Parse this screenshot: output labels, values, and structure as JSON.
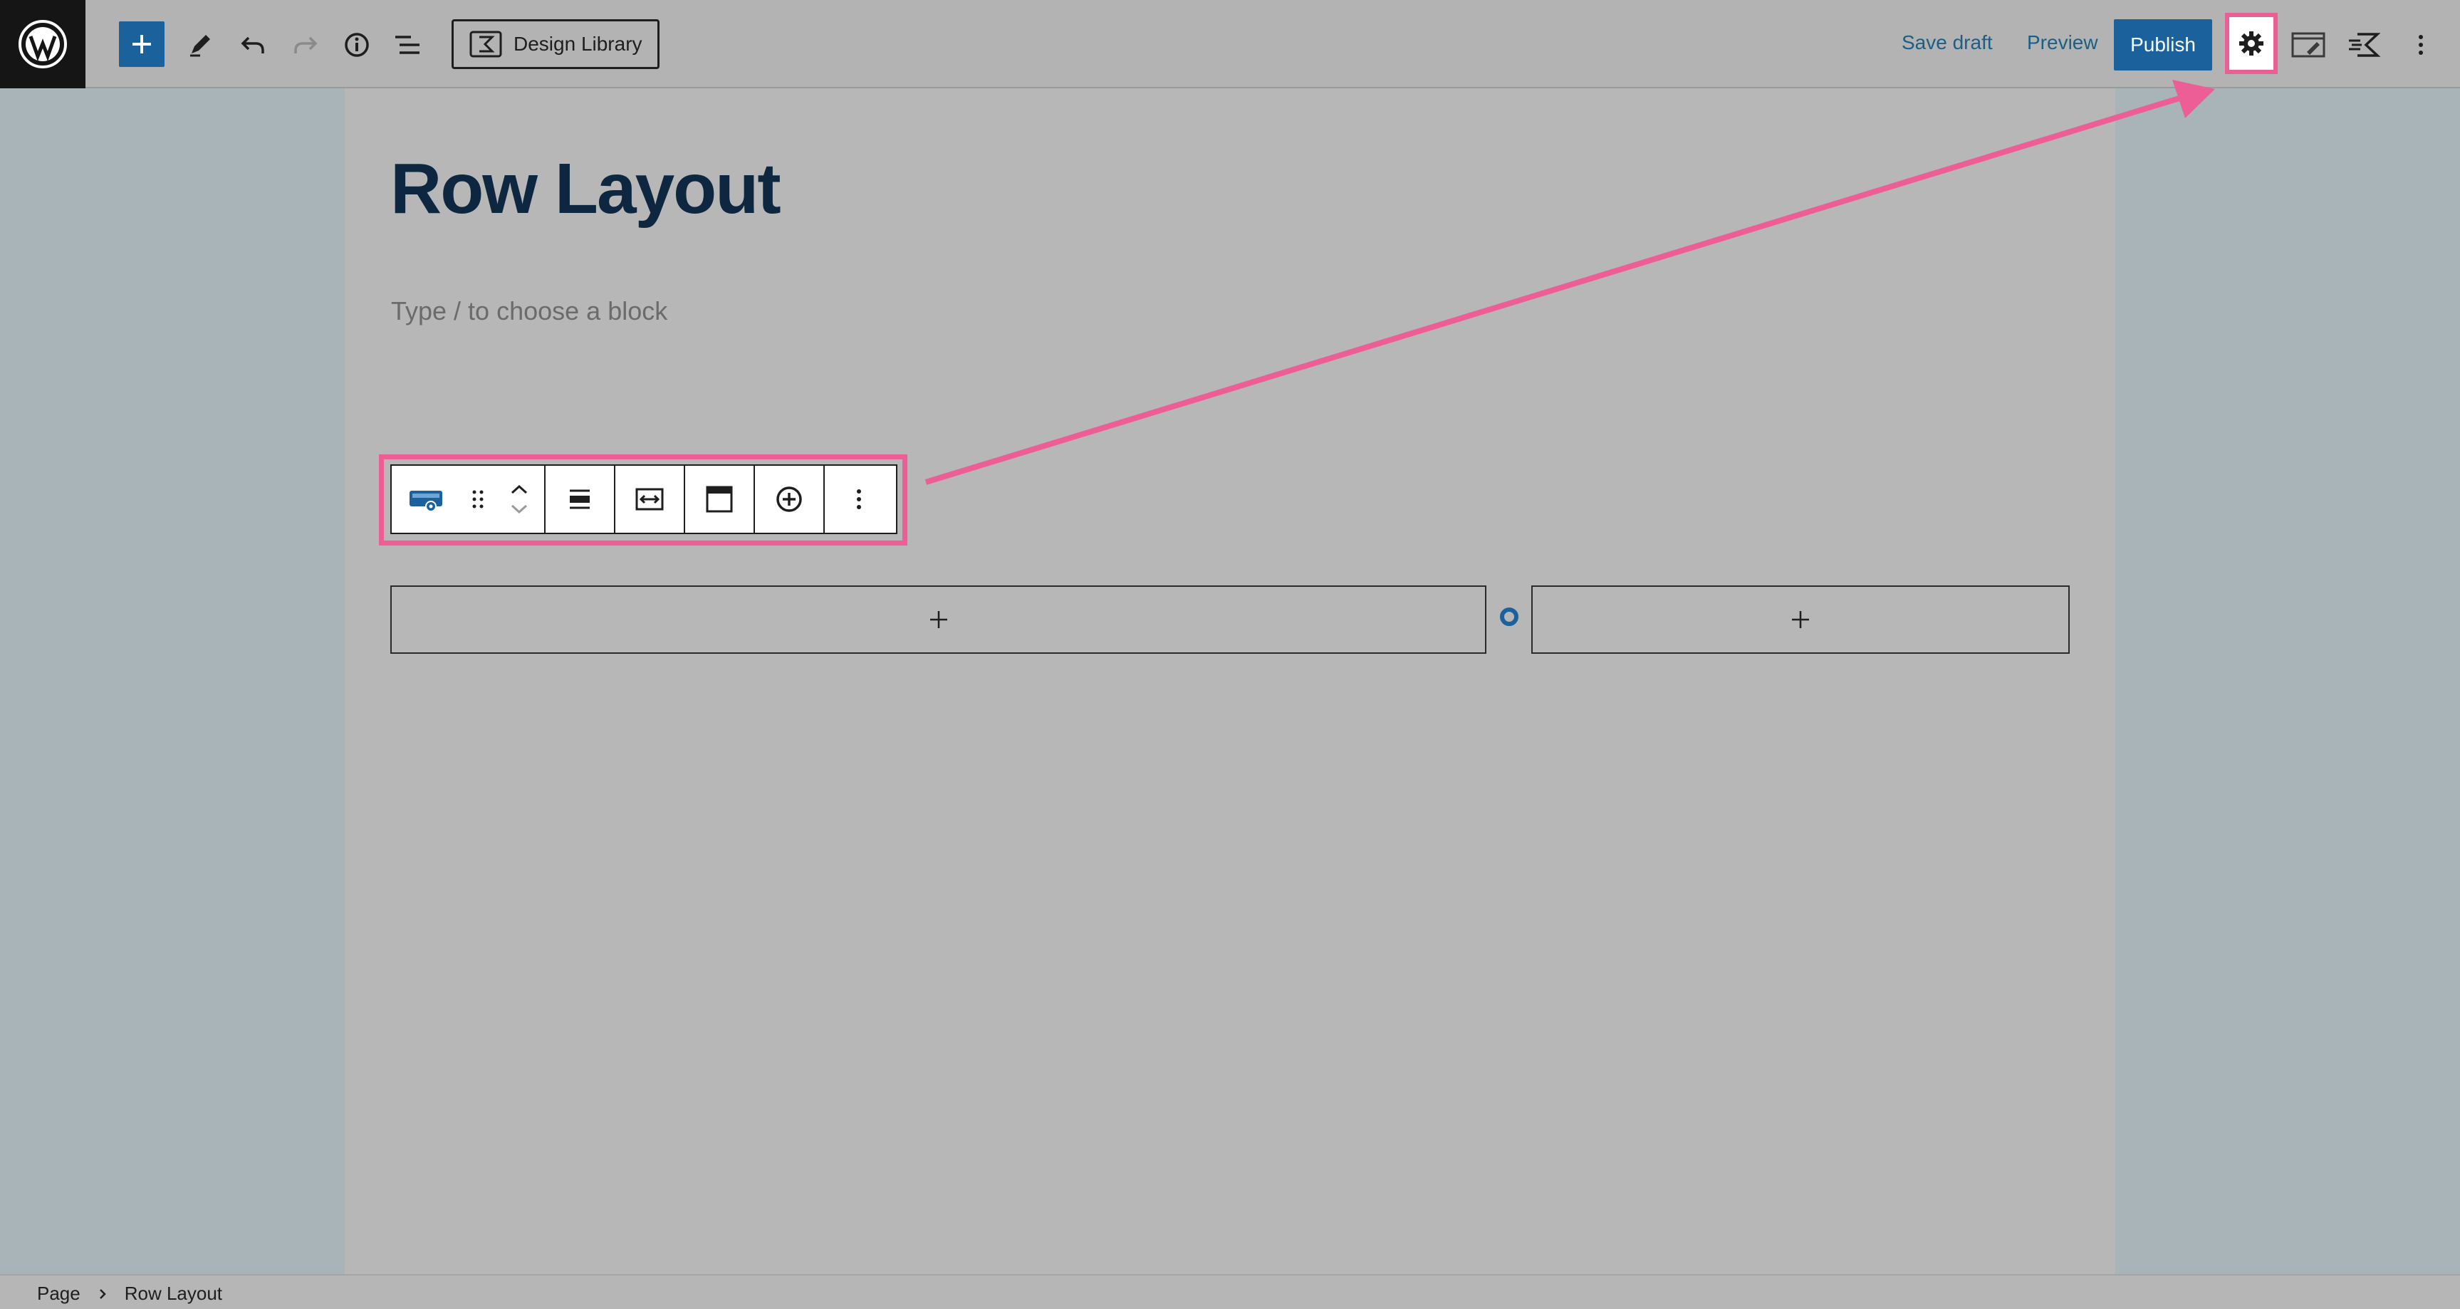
{
  "topbar": {
    "design_library_label": "Design Library",
    "save_draft_label": "Save draft",
    "preview_label": "Preview",
    "publish_label": "Publish",
    "icons": [
      "wordpress-logo-icon",
      "plus-icon",
      "pencil-icon",
      "undo-icon",
      "redo-icon",
      "info-icon",
      "list-view-icon",
      "kadence-icon",
      "gear-icon",
      "kadence-icon",
      "more-vertical-icon"
    ]
  },
  "editor": {
    "title": "Row Layout",
    "placeholder": "Type / to choose a block"
  },
  "block_toolbar": {
    "icons": [
      "row-layout-icon",
      "drag-handle-icon",
      "chevron-up-icon",
      "chevron-down-icon",
      "align-icon",
      "full-width-icon",
      "block-header-icon",
      "add-circle-icon",
      "more-vertical-icon"
    ]
  },
  "row": {
    "column_add_label": "+"
  },
  "footer": {
    "breadcrumb": [
      "Page",
      "Row Layout"
    ]
  },
  "colors": {
    "accent": "#1b629c",
    "annotation": "#ee5e96",
    "title": "#0d2740"
  }
}
